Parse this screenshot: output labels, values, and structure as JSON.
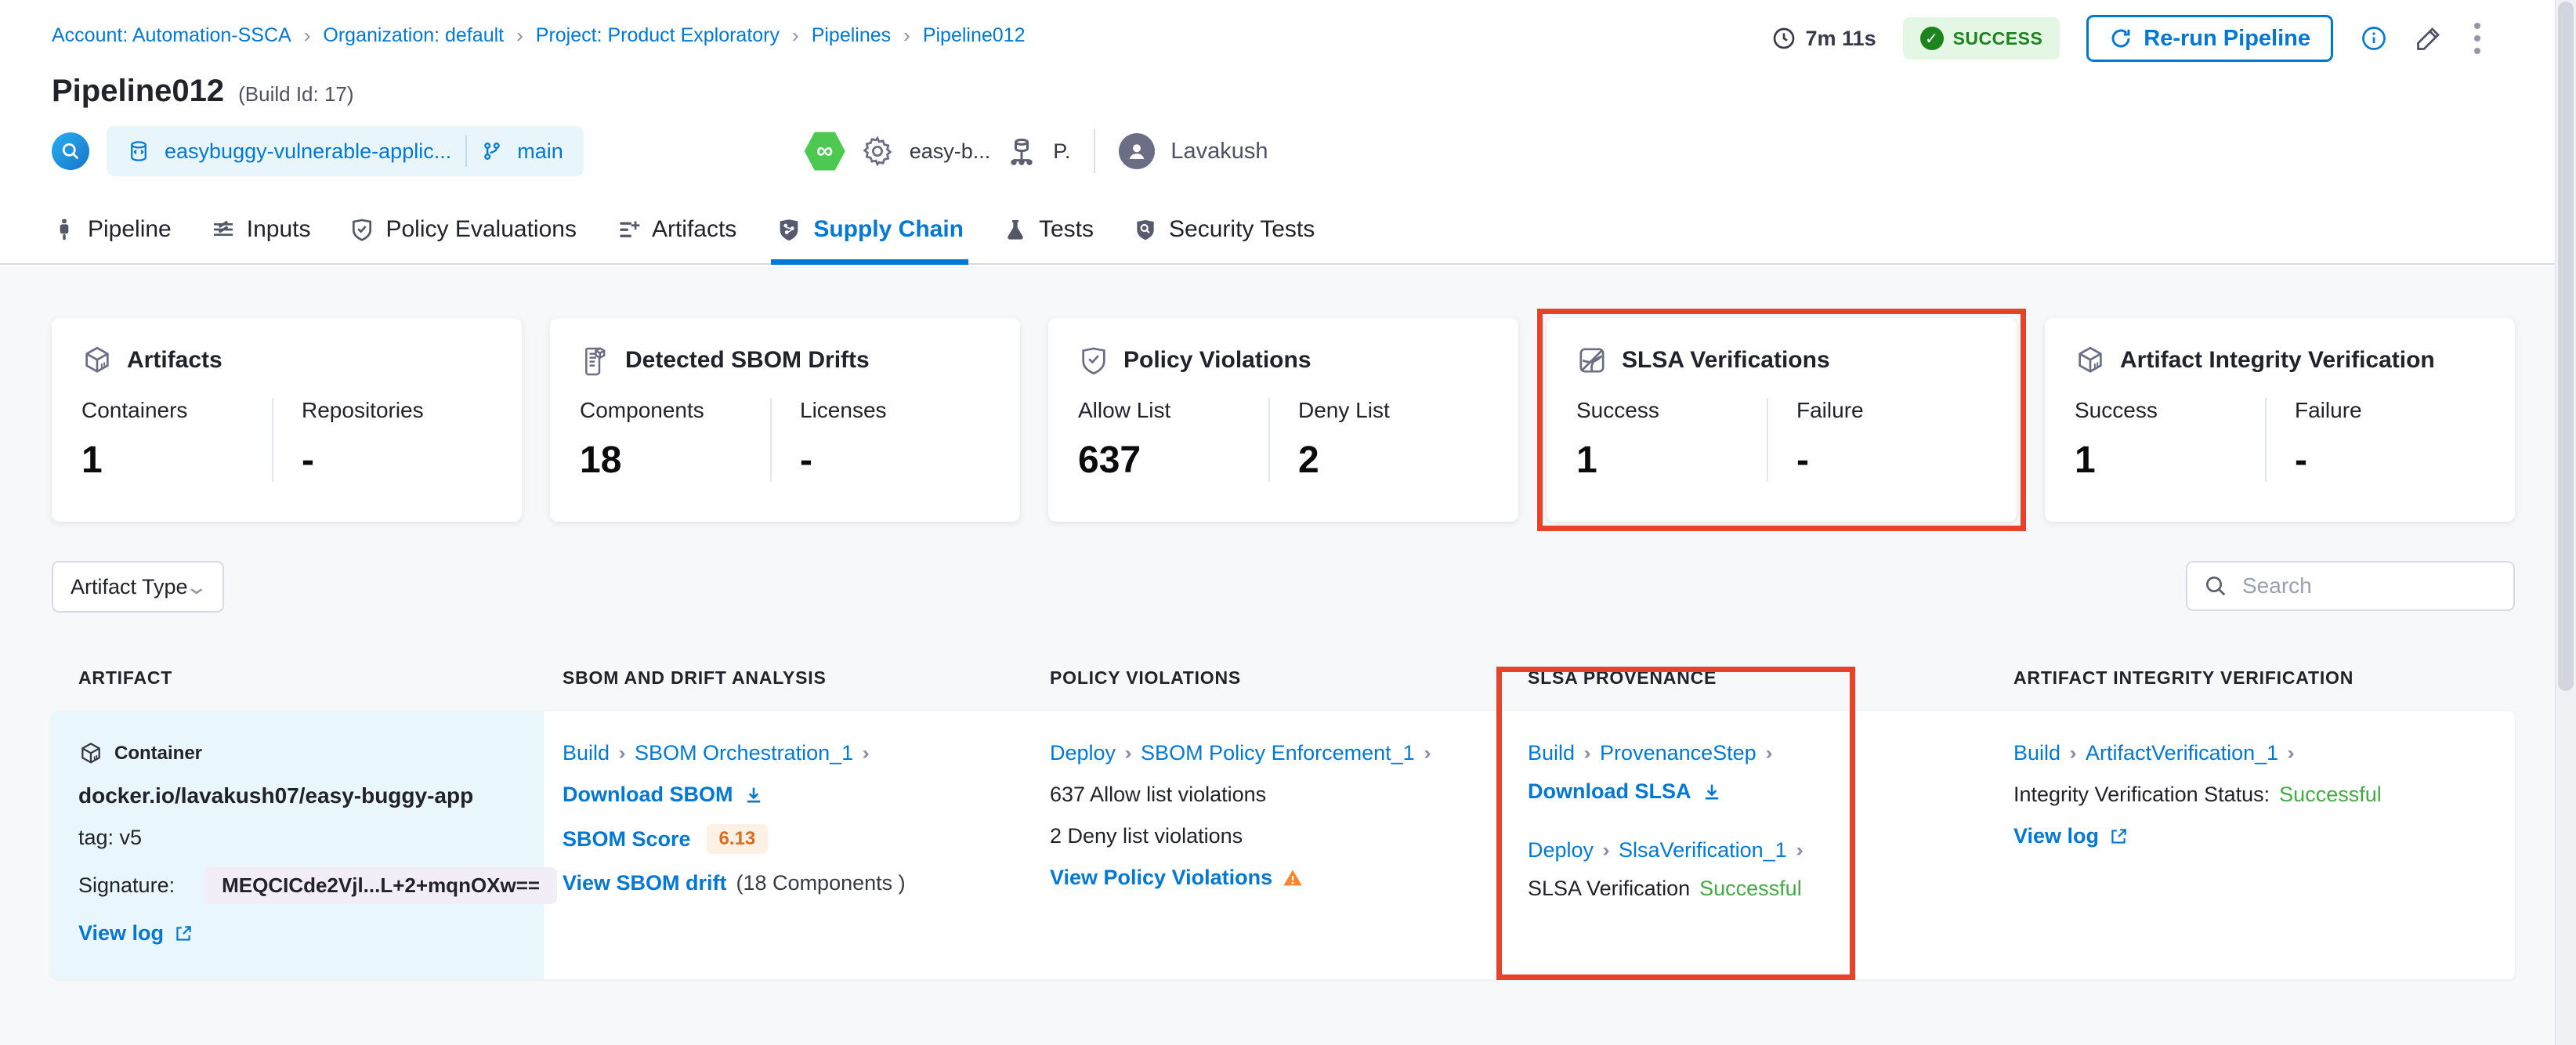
{
  "colors": {
    "accent_blue": "#0278d5",
    "success_green": "#42ab45",
    "badge_green_bg": "#e4f7e4",
    "badge_green_text": "#1b841d",
    "highlight_red": "#e8432a",
    "score_orange": "#dd6b20",
    "artifact_cell_bg": "#e9f6fb",
    "page_bg": "#f6f8fa"
  },
  "header": {
    "breadcrumb": [
      "Account: Automation-SSCA",
      "Organization: default",
      "Project: Product Exploratory",
      "Pipelines",
      "Pipeline012"
    ],
    "duration": "7m 11s",
    "status": "SUCCESS",
    "rerun_label": "Re-run Pipeline",
    "title": "Pipeline012",
    "build_id": "(Build Id: 17)",
    "repo_name": "easybuggy-vulnerable-applic...",
    "branch": "main",
    "trigger_name": "easy-b...",
    "trigger_suffix": "P.",
    "user_name": "Lavakush"
  },
  "tabs": [
    {
      "label": "Pipeline"
    },
    {
      "label": "Inputs"
    },
    {
      "label": "Policy Evaluations"
    },
    {
      "label": "Artifacts"
    },
    {
      "label": "Supply Chain"
    },
    {
      "label": "Tests"
    },
    {
      "label": "Security Tests"
    }
  ],
  "cards": [
    {
      "title": "Artifacts",
      "stats": [
        {
          "label": "Containers",
          "value": "1"
        },
        {
          "label": "Repositories",
          "value": "-"
        }
      ]
    },
    {
      "title": "Detected SBOM Drifts",
      "stats": [
        {
          "label": "Components",
          "value": "18"
        },
        {
          "label": "Licenses",
          "value": "-"
        }
      ]
    },
    {
      "title": "Policy Violations",
      "stats": [
        {
          "label": "Allow List",
          "value": "637"
        },
        {
          "label": "Deny List",
          "value": "2"
        }
      ]
    },
    {
      "title": "SLSA Verifications",
      "stats": [
        {
          "label": "Success",
          "value": "1"
        },
        {
          "label": "Failure",
          "value": "-"
        }
      ]
    },
    {
      "title": "Artifact Integrity Verification",
      "stats": [
        {
          "label": "Success",
          "value": "1"
        },
        {
          "label": "Failure",
          "value": "-"
        }
      ]
    }
  ],
  "filters": {
    "artifact_type_label": "Artifact Type",
    "search_placeholder": "Search"
  },
  "table": {
    "columns": [
      "ARTIFACT",
      "SBOM AND DRIFT ANALYSIS",
      "POLICY VIOLATIONS",
      "SLSA PROVENANCE",
      "ARTIFACT INTEGRITY VERIFICATION"
    ],
    "row": {
      "artifact": {
        "type_label": "Container",
        "image": "docker.io/lavakush07/easy-buggy-app",
        "tag": "tag: v5",
        "signature_label": "Signature:",
        "signature_value": "MEQCICde2Vjl...L+2+mqnOXw==",
        "view_log": "View log"
      },
      "sbom": {
        "stage": "Build",
        "step": "SBOM Orchestration_1",
        "download": "Download SBOM",
        "score_label": "SBOM Score",
        "score": "6.13",
        "drift_link": "View SBOM drift",
        "drift_count": "(18 Components )"
      },
      "policy": {
        "stage": "Deploy",
        "step": "SBOM Policy Enforcement_1",
        "allow": "637 Allow list violations",
        "deny": "2 Deny list violations",
        "view": "View Policy Violations"
      },
      "slsa": {
        "stage1": "Build",
        "step1": "ProvenanceStep",
        "download": "Download SLSA",
        "stage2": "Deploy",
        "step2": "SlsaVerification_1",
        "status_label": "SLSA Verification",
        "status_value": "Successful"
      },
      "integrity": {
        "stage": "Build",
        "step": "ArtifactVerification_1",
        "status_label": "Integrity Verification Status:",
        "status_value": "Successful",
        "view_log": "View log"
      }
    }
  }
}
